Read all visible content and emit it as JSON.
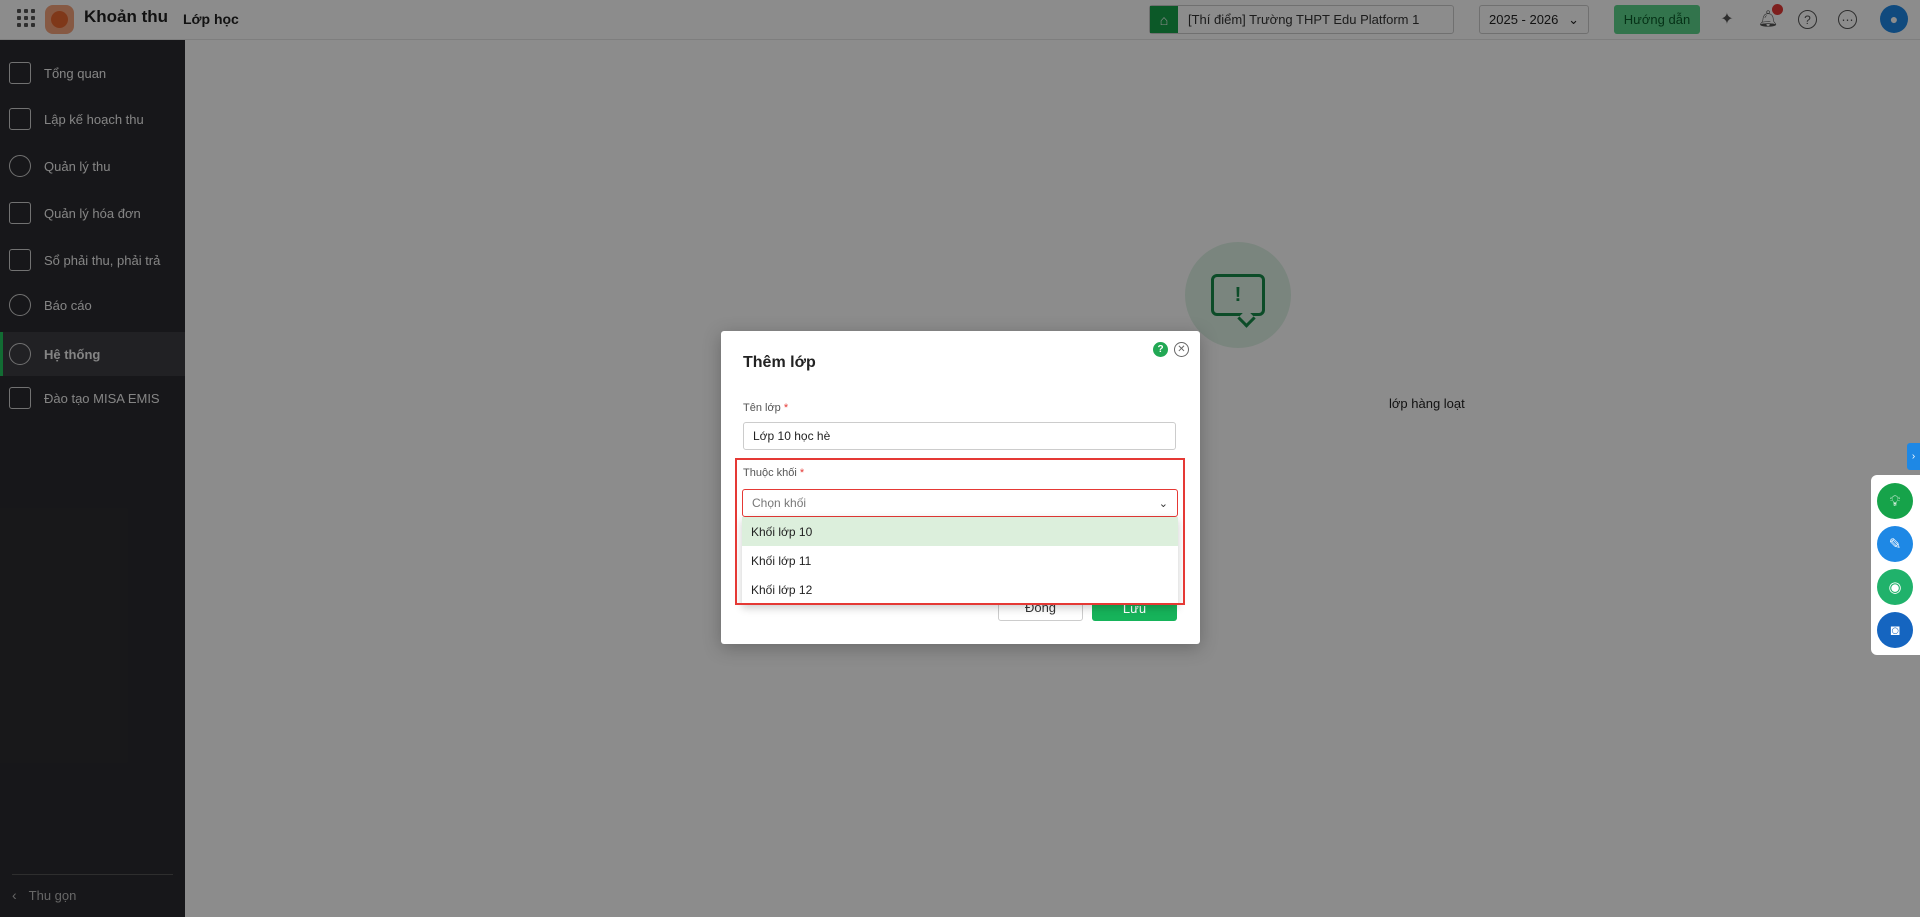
{
  "header": {
    "app_name": "Khoản thu",
    "page_title": "Lớp học",
    "school": "[Thí điểm] Trường THPT Edu Platform 1",
    "year": "2025 - 2026",
    "guide_label": "Hướng dẫn"
  },
  "sidebar": {
    "items": [
      {
        "label": "Tổng quan"
      },
      {
        "label": "Lập kế hoạch thu"
      },
      {
        "label": "Quản lý thu"
      },
      {
        "label": "Quản lý hóa đơn"
      },
      {
        "label": "Sổ phải thu, phải trả"
      },
      {
        "label": "Báo cáo"
      },
      {
        "label": "Hệ thống",
        "active": true
      },
      {
        "label": "Đào tạo MISA EMIS"
      }
    ],
    "collapse_label": "Thu gọn"
  },
  "main": {
    "empty_text": "lớp hàng loạt"
  },
  "dialog": {
    "title": "Thêm lớp",
    "class_name_label": "Tên lớp",
    "class_name_value": "Lớp 10 học hè",
    "grade_label": "Thuộc khối",
    "grade_placeholder": "Chọn khối",
    "options": [
      "Khối lớp 10",
      "Khối lớp 11",
      "Khối lớp 12"
    ],
    "close_label": "Đóng",
    "save_label": "Lưu"
  },
  "colors": {
    "primary": "#16b35a",
    "sidebar_bg": "#2b2b30",
    "highlight": "#e53935"
  }
}
